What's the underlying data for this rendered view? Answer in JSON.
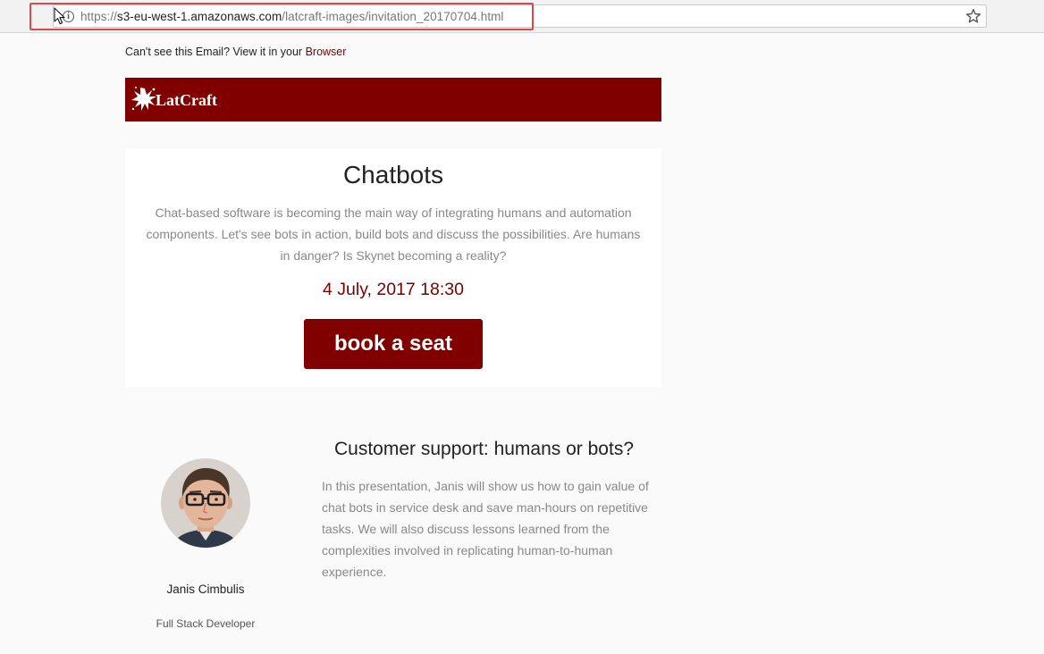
{
  "browser": {
    "url_prefix": "https://",
    "url_host": "s3-eu-west-1.amazonaws.com",
    "url_path": "/latcraft-images/invitation_20170704.html",
    "icons": {
      "site_info": "info-icon",
      "bookmark": "star-icon",
      "pointer": "cursor-icon"
    },
    "highlight_color": "#e0474c"
  },
  "email": {
    "preheader_text": "Can't see this Email? View it in your ",
    "preheader_link": "Browser",
    "brand": {
      "logo_text": "LatCraft",
      "color": "#800000"
    },
    "event": {
      "title": "Chatbots",
      "description": "Chat-based software is becoming the main way of integrating humans and automation components. Let's see bots in action, build bots and discuss the possibilities. Are humans in danger? Is Skynet becoming a reality?",
      "date": "4 July, 2017 18:30",
      "cta_label": "book a seat"
    },
    "talk": {
      "title": "Customer support: humans or bots?",
      "description": "In this presentation, Janis will show us how to gain value of chat bots in service desk and save man-hours on repetitive tasks. We will also discuss lessons learned from the complexities involved in replicating human-to-human experience.",
      "speaker_name": "Janis Cimbulis",
      "speaker_role": "Full Stack Developer"
    }
  }
}
